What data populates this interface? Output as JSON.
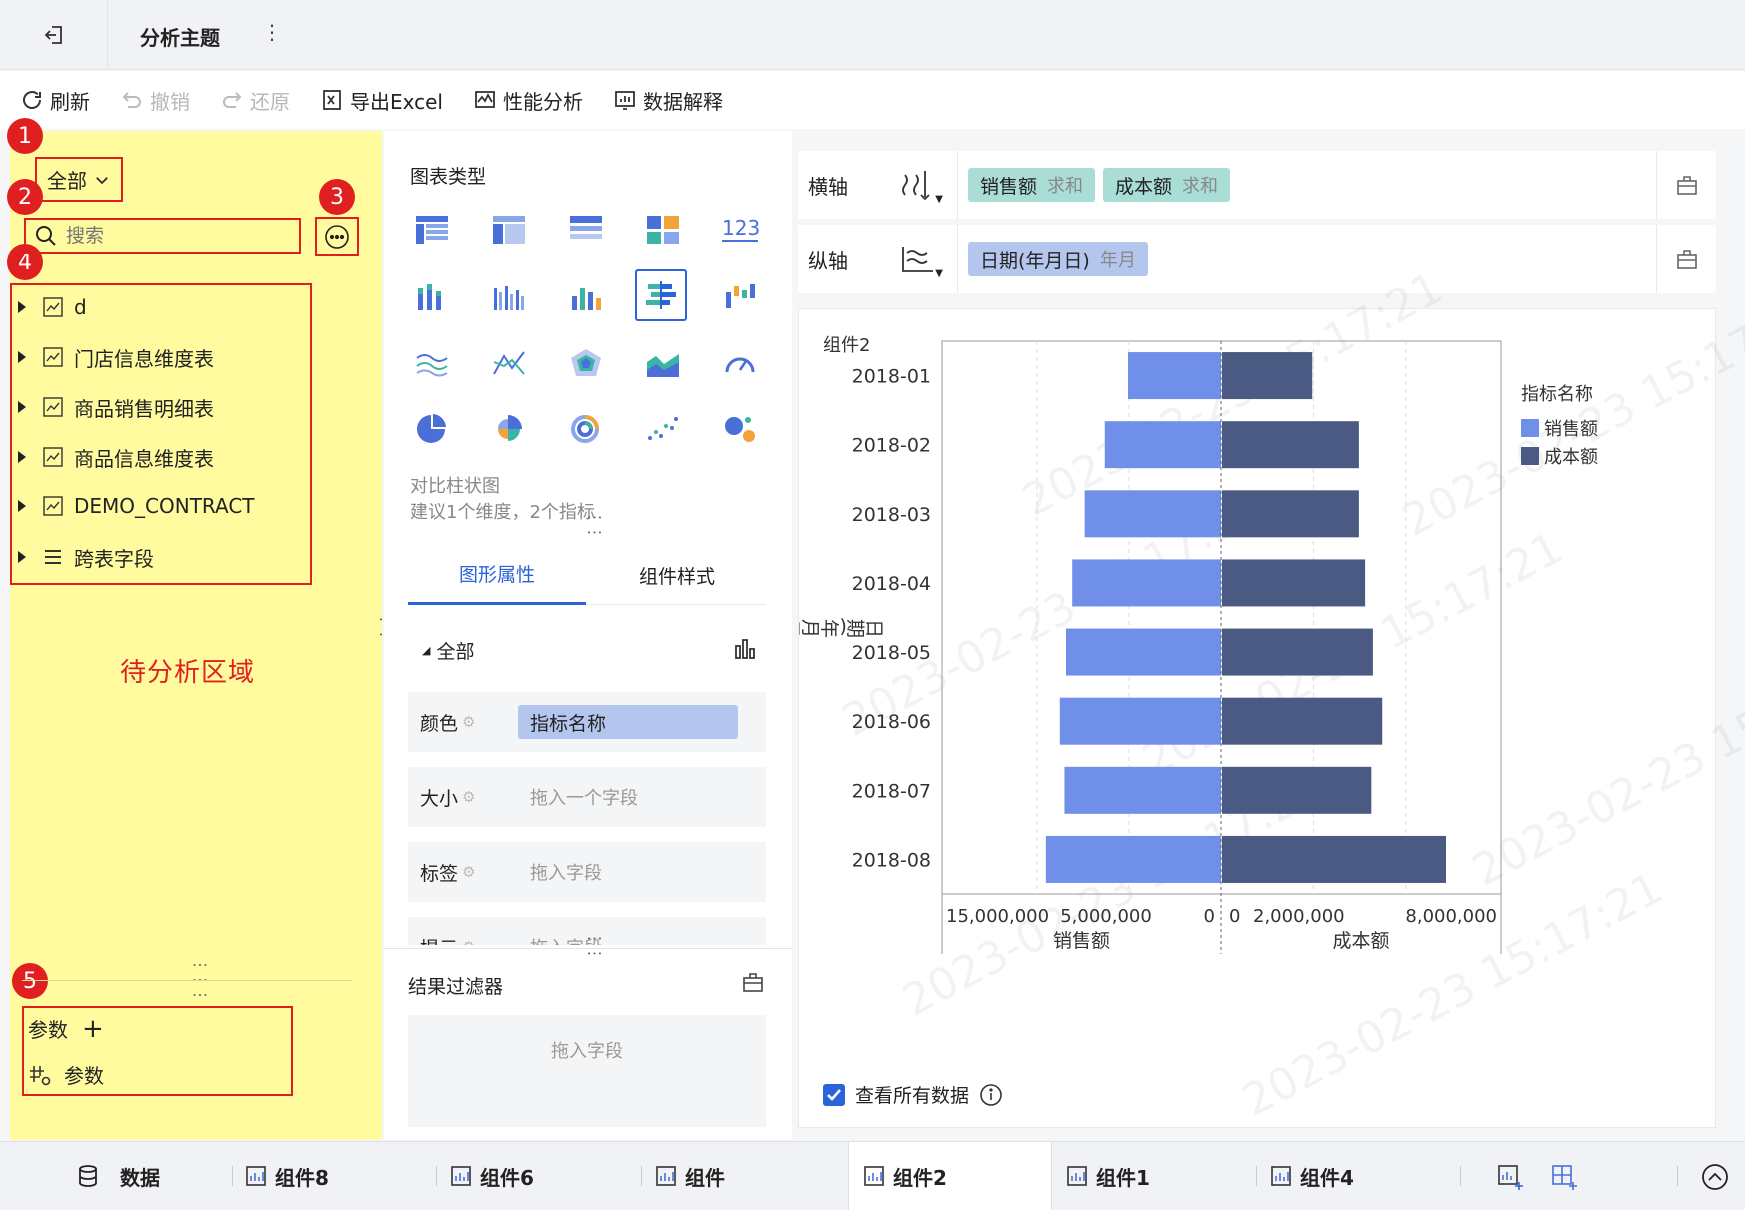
{
  "topbar": {
    "title": "分析主题",
    "more": "⋮"
  },
  "toolbar": {
    "items": [
      {
        "label": "刷新",
        "enabled": true
      },
      {
        "label": "撤销",
        "enabled": false
      },
      {
        "label": "还原",
        "enabled": false
      },
      {
        "label": "导出Excel",
        "enabled": true
      },
      {
        "label": "性能分析",
        "enabled": true
      },
      {
        "label": "数据解释",
        "enabled": true
      }
    ]
  },
  "annotations": [
    "1",
    "2",
    "3",
    "4",
    "5"
  ],
  "left_panel": {
    "scope": "全部",
    "search_placeholder": "搜索",
    "tree": [
      {
        "label": "d",
        "icon": "dataset-icon"
      },
      {
        "label": "门店信息维度表",
        "icon": "dataset-icon"
      },
      {
        "label": "商品销售明细表",
        "icon": "dataset-icon"
      },
      {
        "label": "商品信息维度表",
        "icon": "dataset-icon"
      },
      {
        "label": "DEMO_CONTRACT",
        "icon": "dataset-icon"
      },
      {
        "label": "跨表字段",
        "icon": "list-icon"
      }
    ],
    "area_label": "待分析区域",
    "params_title": "参数",
    "params_add": "+",
    "params_item": "参数"
  },
  "mid_panel": {
    "chart_type_title": "图表类型",
    "chart_desc_name": "对比柱状图",
    "chart_desc_hint": "建议1个维度，2个指标",
    "tabs": [
      "图形属性",
      "组件样式"
    ],
    "section_title": "全部",
    "props": [
      {
        "label": "颜色",
        "value": "指标名称",
        "placeholder": ""
      },
      {
        "label": "大小",
        "value": "",
        "placeholder": "拖入一个字段"
      },
      {
        "label": "标签",
        "value": "",
        "placeholder": "拖入字段"
      },
      {
        "label": "提示",
        "value": "",
        "placeholder": "拖入字段"
      }
    ],
    "filter_title": "结果过滤器",
    "filter_placeholder": "拖入字段"
  },
  "axes": {
    "x_label": "横轴",
    "y_label": "纵轴",
    "x_fields": [
      {
        "name": "销售额",
        "agg": "求和"
      },
      {
        "name": "成本额",
        "agg": "求和"
      }
    ],
    "y_fields": [
      {
        "name": "日期(年月日)",
        "agg": "年月"
      }
    ]
  },
  "chart_panel": {
    "title": "组件2",
    "view_all_label": "查看所有数据",
    "view_all_checked": true,
    "watermark": "2023-02-23 15:17:21"
  },
  "chart_data": {
    "type": "bar",
    "orientation": "horizontal-diverging",
    "categories": [
      "2018-01",
      "2018-02",
      "2018-03",
      "2018-04",
      "2018-05",
      "2018-06",
      "2018-07",
      "2018-08"
    ],
    "y_axis_title": "日期(年月日)",
    "legend_title": "指标名称",
    "legend_position": "right",
    "series": [
      {
        "name": "销售额",
        "color": "#6f8fe8",
        "values": [
          6000000,
          7500000,
          8800000,
          9600000,
          10000000,
          10400000,
          10100000,
          11300000
        ],
        "axis_label": "销售额",
        "ticks": [
          "15,000,000",
          "5,000,000",
          "0"
        ]
      },
      {
        "name": "成本额",
        "color": "#4a5a82",
        "values": [
          2900000,
          4400000,
          4400000,
          4600000,
          4850000,
          5150000,
          4800000,
          7200000
        ],
        "axis_label": "成本额",
        "ticks": [
          "0",
          "2,000,000",
          "8,000,000"
        ]
      }
    ],
    "left_xlim": [
      0,
      18000000
    ],
    "right_xlim": [
      0,
      9000000
    ]
  },
  "bottom_tabs": [
    {
      "label": "数据",
      "icon": "database-icon",
      "active": false
    },
    {
      "label": "组件8",
      "icon": "chart-icon",
      "active": false
    },
    {
      "label": "组件6",
      "icon": "chart-icon",
      "active": false
    },
    {
      "label": "组件",
      "icon": "chart-icon",
      "active": false
    },
    {
      "label": "组件2",
      "icon": "chart-icon",
      "active": true
    },
    {
      "label": "组件1",
      "icon": "chart-icon",
      "active": false
    },
    {
      "label": "组件4",
      "icon": "chart-icon",
      "active": false
    }
  ]
}
